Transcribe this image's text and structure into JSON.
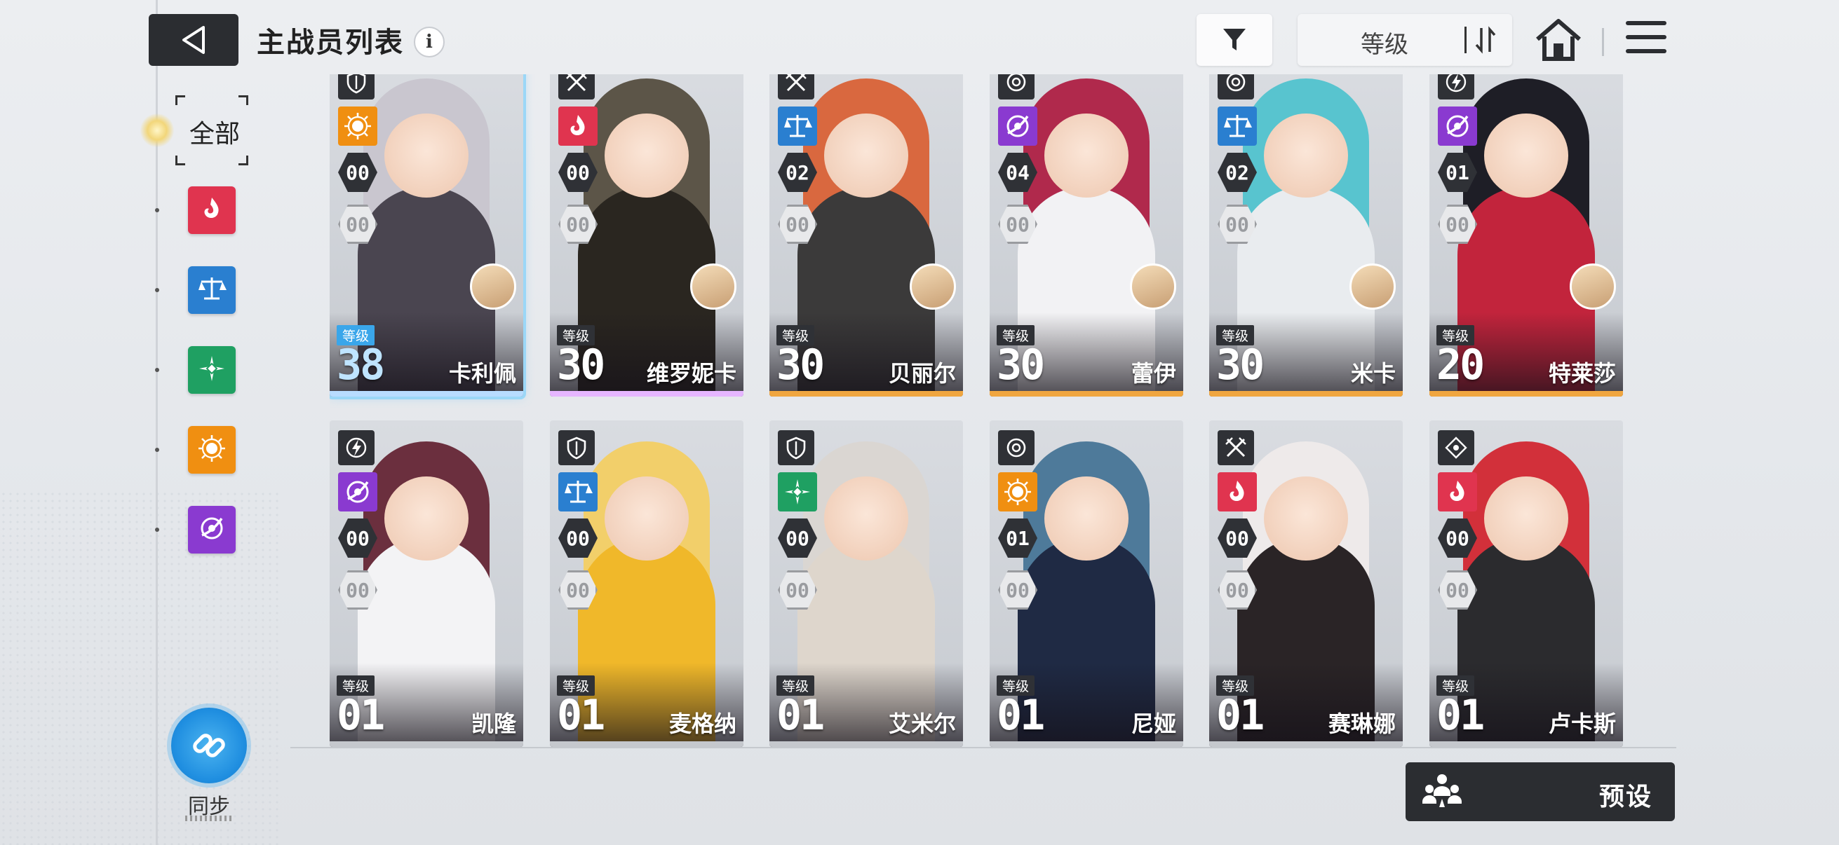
{
  "header": {
    "title": "主战员列表",
    "info_glyph": "i",
    "sort_label": "等级"
  },
  "sidebar": {
    "all_label": "全部",
    "elements": [
      {
        "name": "fire",
        "color": "#e0344f"
      },
      {
        "name": "order",
        "color": "#2a7fd0"
      },
      {
        "name": "wind",
        "color": "#1fa062"
      },
      {
        "name": "light",
        "color": "#f08f11"
      },
      {
        "name": "void",
        "color": "#8a3ad0"
      }
    ],
    "sync_label": "同步"
  },
  "level_tag": "等级",
  "cards": [
    {
      "name": "卡利佩",
      "level": "38",
      "rank_a": "00",
      "rank_b": "00",
      "role": "shield",
      "element": "light",
      "element_color": "#f08f11",
      "hair": "#c9c6cf",
      "outfit": "#4a4550",
      "rarity": "#b8dcff",
      "selected": true,
      "has_avatar": true
    },
    {
      "name": "维罗妮卡",
      "level": "30",
      "rank_a": "00",
      "rank_b": "00",
      "role": "blades",
      "element": "fire",
      "element_color": "#e0344f",
      "hair": "#5c5548",
      "outfit": "#2a2620",
      "rarity": "#e6b6ff",
      "selected": false,
      "has_avatar": true
    },
    {
      "name": "贝丽尔",
      "level": "30",
      "rank_a": "02",
      "rank_b": "00",
      "role": "blades",
      "element": "order",
      "element_color": "#2a7fd0",
      "hair": "#d9683f",
      "outfit": "#3b3a3a",
      "rarity": "#f0a640",
      "selected": false,
      "has_avatar": true
    },
    {
      "name": "蕾伊",
      "level": "30",
      "rank_a": "04",
      "rank_b": "00",
      "role": "target",
      "element": "void",
      "element_color": "#8a3ad0",
      "hair": "#b0294c",
      "outfit": "#f2f2f4",
      "rarity": "#f0a640",
      "selected": false,
      "has_avatar": true
    },
    {
      "name": "米卡",
      "level": "30",
      "rank_a": "02",
      "rank_b": "00",
      "role": "target",
      "element": "order",
      "element_color": "#2a7fd0",
      "hair": "#58c4cf",
      "outfit": "#e9ecef",
      "rarity": "#f0a640",
      "selected": false,
      "has_avatar": true
    },
    {
      "name": "特莱莎",
      "level": "20",
      "rank_a": "01",
      "rank_b": "00",
      "role": "bolt",
      "element": "void",
      "element_color": "#8a3ad0",
      "hair": "#1e1e26",
      "outfit": "#c2243c",
      "rarity": "#f0a640",
      "selected": false,
      "has_avatar": true
    },
    {
      "name": "凯隆",
      "level": "01",
      "rank_a": "00",
      "rank_b": "00",
      "role": "bolt",
      "element": "void",
      "element_color": "#8a3ad0",
      "hair": "#6b2f3e",
      "outfit": "#f3f3f5",
      "rarity": "#c5c8cd",
      "selected": false,
      "has_avatar": false
    },
    {
      "name": "麦格纳",
      "level": "01",
      "rank_a": "00",
      "rank_b": "00",
      "role": "shield",
      "element": "order",
      "element_color": "#2a7fd0",
      "hair": "#f2cf6a",
      "outfit": "#f0b82a",
      "rarity": "#c5c8cd",
      "selected": false,
      "has_avatar": false
    },
    {
      "name": "艾米尔",
      "level": "01",
      "rank_a": "00",
      "rank_b": "00",
      "role": "shield",
      "element": "wind",
      "element_color": "#1fa062",
      "hair": "#dad6d2",
      "outfit": "#ded6cc",
      "rarity": "#c5c8cd",
      "selected": false,
      "has_avatar": false
    },
    {
      "name": "尼娅",
      "level": "01",
      "rank_a": "01",
      "rank_b": "00",
      "role": "target",
      "element": "light",
      "element_color": "#f08f11",
      "hair": "#4e7a9a",
      "outfit": "#1f2a44",
      "rarity": "#c5c8cd",
      "selected": false,
      "has_avatar": false
    },
    {
      "name": "赛琳娜",
      "level": "01",
      "rank_a": "00",
      "rank_b": "00",
      "role": "blades",
      "element": "fire",
      "element_color": "#e0344f",
      "hair": "#eeeaea",
      "outfit": "#2a2426",
      "rarity": "#c5c8cd",
      "selected": false,
      "has_avatar": false
    },
    {
      "name": "卢卡斯",
      "level": "01",
      "rank_a": "00",
      "rank_b": "00",
      "role": "crosshair",
      "element": "fire",
      "element_color": "#e0344f",
      "hair": "#d2303a",
      "outfit": "#2b2b2e",
      "rarity": "#c5c8cd",
      "selected": false,
      "has_avatar": false
    }
  ],
  "footer": {
    "preset_label": "预设"
  }
}
